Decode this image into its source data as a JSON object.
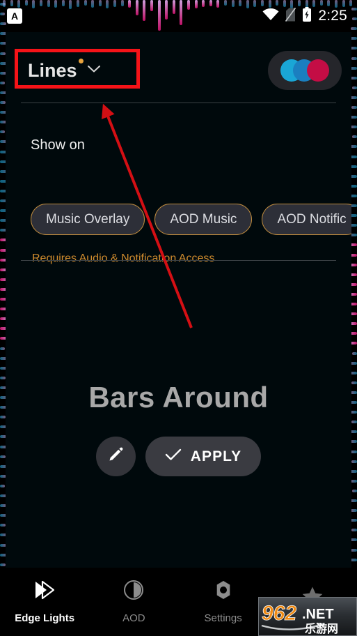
{
  "statusbar": {
    "app_badge_letter": "A",
    "app_badge_name": "app-letter-badge",
    "wifi_icon": "wifi-icon",
    "sim_icon": "sim-card-off-icon",
    "battery_icon": "battery-charging-icon",
    "time": "2:25"
  },
  "header": {
    "preset_name": "Lines",
    "has_unsaved_dot": true,
    "chevron_icon": "chevron-down-icon",
    "palette": {
      "name": "color-palette-pill",
      "colors": [
        "#1aa6d6",
        "#1b7fc0",
        "#c40d45"
      ]
    }
  },
  "show_on": {
    "label": "Show on",
    "chips": [
      {
        "label": "Music Overlay"
      },
      {
        "label": "AOD Music"
      },
      {
        "label": "AOD Notific"
      }
    ],
    "requires_note": "Requires Audio & Notification Access",
    "note_color": "#d08c2e",
    "chip_border_color": "#c08c3e"
  },
  "hero": {
    "title": "Bars Around",
    "edit_icon": "pencil-icon",
    "apply_check_icon": "check-icon",
    "apply_label": "APPLY"
  },
  "pager": {
    "count": 5,
    "active_index": 2
  },
  "bottom_nav": {
    "items": [
      {
        "label": "Edge Lights",
        "icon": "edge-lights-arrow-icon",
        "active": true
      },
      {
        "label": "AOD",
        "icon": "half-moon-icon",
        "active": false
      },
      {
        "label": "Settings",
        "icon": "gear-icon",
        "active": false
      },
      {
        "label": "",
        "icon": "star-icon",
        "active": false
      }
    ]
  },
  "watermark": {
    "number": "962",
    "domain": ".NET",
    "chinese": "乐游网"
  },
  "annotations": {
    "highlight_box_color": "#f51318",
    "arrow_color": "#d40f14"
  },
  "edge_lights": {
    "colors": [
      "#16b3e8",
      "#d9a8e8",
      "#c8116a",
      "#e07ab5"
    ]
  }
}
